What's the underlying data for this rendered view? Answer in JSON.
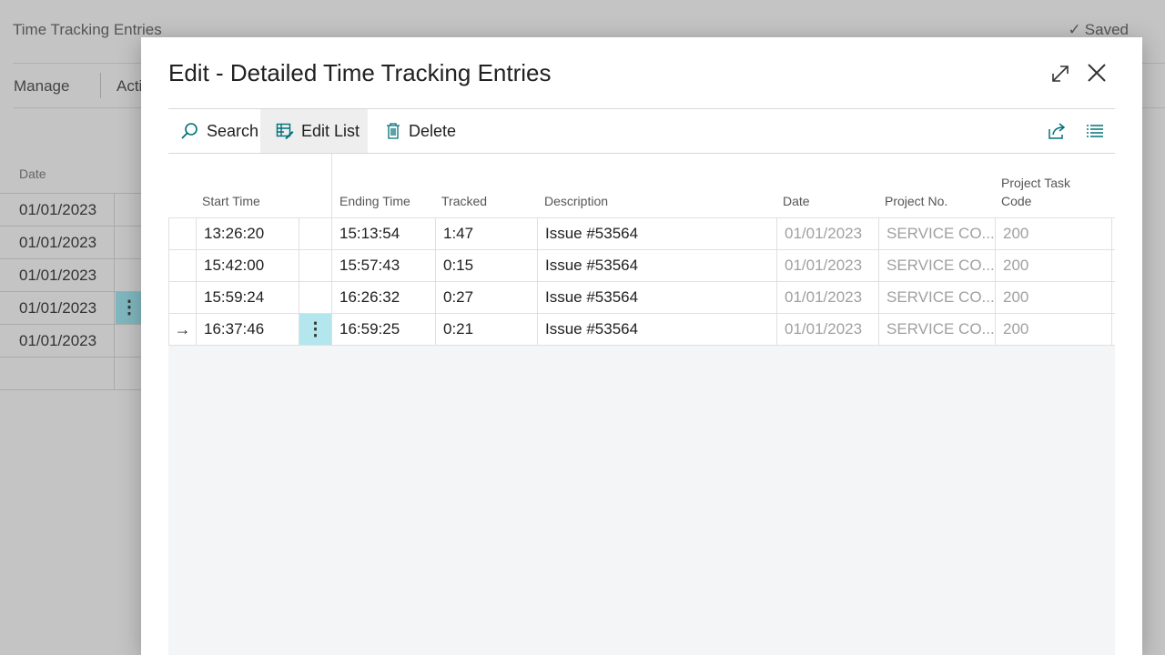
{
  "background": {
    "title": "Time Tracking Entries",
    "saved": "Saved",
    "menu": {
      "manage": "Manage",
      "actions": "Acti"
    },
    "column_header": "Date",
    "rows": [
      "01/01/2023",
      "01/01/2023",
      "01/01/2023",
      "01/01/2023",
      "01/01/2023",
      ""
    ]
  },
  "dialog": {
    "title": "Edit - Detailed Time Tracking Entries",
    "toolbar": {
      "search": "Search",
      "edit_list": "Edit List",
      "delete": "Delete"
    },
    "columns": {
      "start_time": "Start Time",
      "ending_time": "Ending Time",
      "tracked": "Tracked",
      "description": "Description",
      "date": "Date",
      "project_no": "Project No.",
      "project_task_code_1": "Project Task",
      "project_task_code_2": "Code"
    },
    "rows": [
      {
        "start": "13:26:20",
        "ending": "15:13:54",
        "tracked": "1:47",
        "description": "Issue #53564",
        "date": "01/01/2023",
        "project": "SERVICE CO...",
        "task": "200"
      },
      {
        "start": "15:42:00",
        "ending": "15:57:43",
        "tracked": "0:15",
        "description": "Issue #53564",
        "date": "01/01/2023",
        "project": "SERVICE CO...",
        "task": "200"
      },
      {
        "start": "15:59:24",
        "ending": "16:26:32",
        "tracked": "0:27",
        "description": "Issue #53564",
        "date": "01/01/2023",
        "project": "SERVICE CO...",
        "task": "200"
      },
      {
        "start": "16:37:46",
        "ending": "16:59:25",
        "tracked": "0:21",
        "description": "Issue #53564",
        "date": "01/01/2023",
        "project": "SERVICE CO...",
        "task": "200"
      }
    ],
    "row_marker": "→",
    "row_menu_glyph": "⋮"
  },
  "colors": {
    "accent": "#00707a",
    "selected_cell": "#b4e6ee"
  }
}
